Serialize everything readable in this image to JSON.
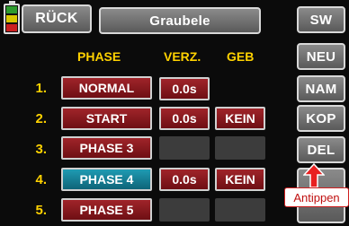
{
  "header": {
    "back_label": "RÜCK",
    "model_name": "Graubele"
  },
  "columns": {
    "phase": "PHASE",
    "verz": "VERZ.",
    "geb": "GEB"
  },
  "rows": [
    {
      "num": "1.",
      "phase": "NORMAL",
      "verz": "0.0s",
      "geb": ""
    },
    {
      "num": "2.",
      "phase": "START",
      "verz": "0.0s",
      "geb": "KEIN"
    },
    {
      "num": "3.",
      "phase": "PHASE 3",
      "verz": "",
      "geb": ""
    },
    {
      "num": "4.",
      "phase": "PHASE 4",
      "verz": "0.0s",
      "geb": "KEIN"
    },
    {
      "num": "5.",
      "phase": "PHASE 5",
      "verz": "",
      "geb": ""
    }
  ],
  "side_buttons": {
    "sw": "SW",
    "neu": "NEU",
    "nam": "NAM",
    "kop": "KOP",
    "del": "DEL"
  },
  "annotation": {
    "label": "Antippen"
  },
  "colors": {
    "phase_red": "#8b1a20",
    "phase_selected": "#157c93",
    "label_yellow": "#ffd200",
    "annotation_red": "#d02020"
  },
  "icons": {
    "battery": "battery-icon",
    "arrow": "up-arrow-icon"
  }
}
